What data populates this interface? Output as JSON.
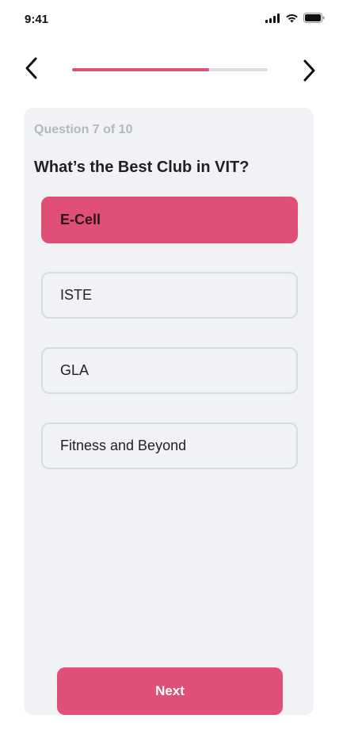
{
  "status_bar": {
    "time": "9:41"
  },
  "navigation": {
    "back_icon": "chevron-left-icon",
    "next_icon": "chevron-right-icon"
  },
  "progress": {
    "value": 0.7,
    "fill_color": "#e04f75",
    "track_color": "#dcdde1"
  },
  "quiz": {
    "counter": "Question 7 of 10",
    "question": "What’s the Best Club in VIT?",
    "options": [
      {
        "label": "E-Cell",
        "selected": true
      },
      {
        "label": "ISTE",
        "selected": false
      },
      {
        "label": "GLA",
        "selected": false
      },
      {
        "label": "Fitness and Beyond",
        "selected": false
      }
    ]
  },
  "actions": {
    "next_label": "Next"
  },
  "colors": {
    "accent": "#e04f75",
    "card_bg": "#f0f2f6"
  }
}
